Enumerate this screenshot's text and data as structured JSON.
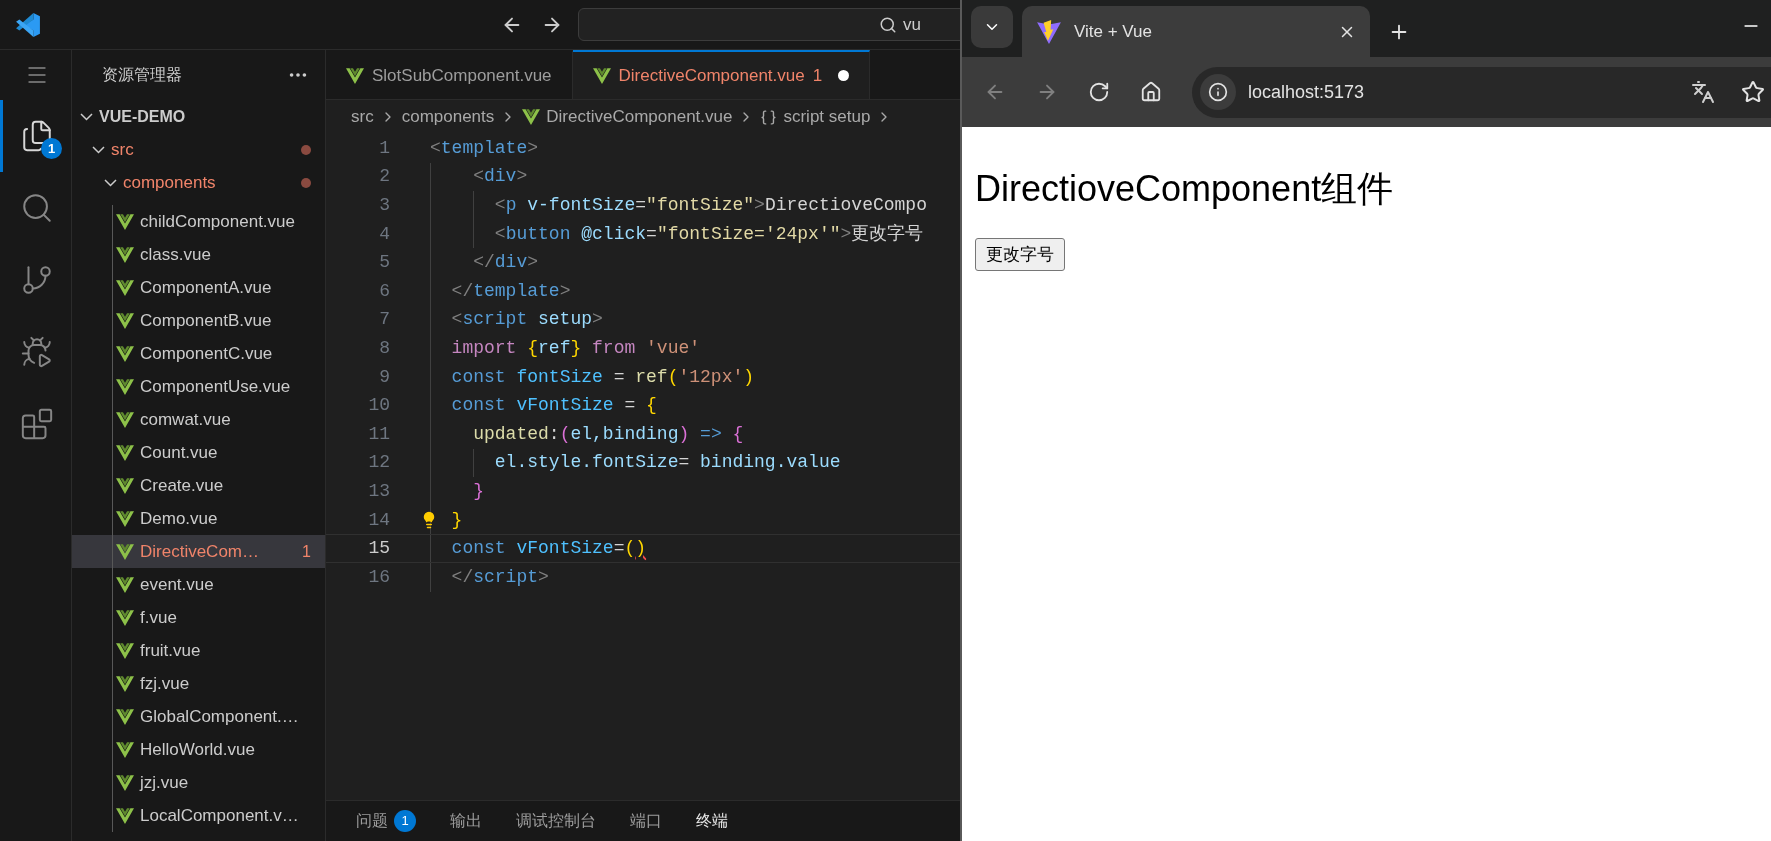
{
  "title_bar": {
    "search": {
      "value": "vu"
    }
  },
  "activity_bar": [
    {
      "kind": "menu",
      "selected": false
    },
    {
      "kind": "explorer",
      "selected": true,
      "badge": "1"
    },
    {
      "kind": "search",
      "selected": false
    },
    {
      "kind": "source-control",
      "selected": false
    },
    {
      "kind": "run-debug",
      "selected": false
    },
    {
      "kind": "extensions",
      "selected": false
    }
  ],
  "sidebar": {
    "title": "资源管理器",
    "tree": [
      {
        "name": "VUE-DEMO",
        "kind": "root",
        "expanded": true,
        "problem": false,
        "selected": false,
        "children": [
          {
            "name": "src",
            "kind": "folder",
            "expanded": true,
            "problem": true,
            "selected": false,
            "children": [
              {
                "name": "components",
                "kind": "folder",
                "expanded": true,
                "problem": true,
                "selected": false,
                "children": [
                  {
                    "name": "childComponent.vue",
                    "kind": "file",
                    "problem": false,
                    "selected": false
                  },
                  {
                    "name": "class.vue",
                    "kind": "file",
                    "problem": false,
                    "selected": false
                  },
                  {
                    "name": "ComponentA.vue",
                    "kind": "file",
                    "problem": false,
                    "selected": false
                  },
                  {
                    "name": "ComponentB.vue",
                    "kind": "file",
                    "problem": false,
                    "selected": false
                  },
                  {
                    "name": "ComponentC.vue",
                    "kind": "file",
                    "problem": false,
                    "selected": false
                  },
                  {
                    "name": "ComponentUse.vue",
                    "kind": "file",
                    "problem": false,
                    "selected": false
                  },
                  {
                    "name": "comwat.vue",
                    "kind": "file",
                    "problem": false,
                    "selected": false
                  },
                  {
                    "name": "Count.vue",
                    "kind": "file",
                    "problem": false,
                    "selected": false
                  },
                  {
                    "name": "Create.vue",
                    "kind": "file",
                    "problem": false,
                    "selected": false
                  },
                  {
                    "name": "Demo.vue",
                    "kind": "file",
                    "problem": false,
                    "selected": false
                  },
                  {
                    "name": "DirectiveCom…",
                    "kind": "file",
                    "problem": true,
                    "selected": true,
                    "badge": "1"
                  },
                  {
                    "name": "event.vue",
                    "kind": "file",
                    "problem": false,
                    "selected": false
                  },
                  {
                    "name": "f.vue",
                    "kind": "file",
                    "problem": false,
                    "selected": false
                  },
                  {
                    "name": "fruit.vue",
                    "kind": "file",
                    "problem": false,
                    "selected": false
                  },
                  {
                    "name": "fzj.vue",
                    "kind": "file",
                    "problem": false,
                    "selected": false
                  },
                  {
                    "name": "GlobalComponent.…",
                    "kind": "file",
                    "problem": false,
                    "selected": false
                  },
                  {
                    "name": "HelloWorld.vue",
                    "kind": "file",
                    "problem": false,
                    "selected": false
                  },
                  {
                    "name": "jzj.vue",
                    "kind": "file",
                    "problem": false,
                    "selected": false
                  },
                  {
                    "name": "LocalComponent.v…",
                    "kind": "file",
                    "problem": false,
                    "selected": false
                  }
                ]
              }
            ]
          }
        ]
      }
    ]
  },
  "editor": {
    "tabs": [
      {
        "label": "SlotSubComponent.vue",
        "selected": false,
        "problem": false,
        "modified": false
      },
      {
        "label": "DirectiveComponent.vue",
        "selected": true,
        "problem": true,
        "badge": "1",
        "modified": true
      }
    ],
    "breadcrumb": [
      {
        "text": "src",
        "kind": "folder"
      },
      {
        "text": "components",
        "kind": "folder"
      },
      {
        "text": "DirectiveComponent.vue",
        "kind": "vue-file"
      },
      {
        "text": "script setup",
        "kind": "symbol"
      }
    ],
    "lines": [
      {
        "number": "1",
        "current": false,
        "hint": false,
        "tokens": [
          {
            "text": "<",
            "kind": "punct"
          },
          {
            "text": "template",
            "kind": "tag"
          },
          {
            "text": ">",
            "kind": "punct"
          }
        ]
      },
      {
        "number": "2",
        "current": false,
        "hint": false,
        "tokens": [
          {
            "text": "    <",
            "kind": "punct"
          },
          {
            "text": "div",
            "kind": "tag"
          },
          {
            "text": ">",
            "kind": "punct"
          }
        ]
      },
      {
        "number": "3",
        "current": false,
        "hint": false,
        "tokens": [
          {
            "text": "      <",
            "kind": "punct"
          },
          {
            "text": "p",
            "kind": "tag"
          },
          {
            "text": " v-fontSize",
            "kind": "attr"
          },
          {
            "text": "=",
            "kind": "op"
          },
          {
            "text": "\"fontSize\"",
            "kind": "expr"
          },
          {
            "text": ">",
            "kind": "punct"
          },
          {
            "text": "DirectioveCompo",
            "kind": "text"
          }
        ]
      },
      {
        "number": "4",
        "current": false,
        "hint": false,
        "tokens": [
          {
            "text": "      <",
            "kind": "punct"
          },
          {
            "text": "button",
            "kind": "tag"
          },
          {
            "text": " @click",
            "kind": "attr"
          },
          {
            "text": "=",
            "kind": "op"
          },
          {
            "text": "\"fontSize='24px'\"",
            "kind": "expr"
          },
          {
            "text": ">",
            "kind": "punct"
          },
          {
            "text": "更改字号",
            "kind": "text"
          }
        ]
      },
      {
        "number": "5",
        "current": false,
        "hint": false,
        "tokens": [
          {
            "text": "    </",
            "kind": "punct"
          },
          {
            "text": "div",
            "kind": "tag"
          },
          {
            "text": ">",
            "kind": "punct"
          }
        ]
      },
      {
        "number": "6",
        "current": false,
        "hint": false,
        "tokens": [
          {
            "text": "  </",
            "kind": "punct"
          },
          {
            "text": "template",
            "kind": "tag"
          },
          {
            "text": ">",
            "kind": "punct"
          }
        ]
      },
      {
        "number": "7",
        "current": false,
        "hint": false,
        "tokens": [
          {
            "text": "  <",
            "kind": "punct"
          },
          {
            "text": "script",
            "kind": "tag"
          },
          {
            "text": " setup",
            "kind": "attr"
          },
          {
            "text": ">",
            "kind": "punct"
          }
        ]
      },
      {
        "number": "8",
        "current": false,
        "hint": false,
        "tokens": [
          {
            "text": "  import ",
            "kind": "keyword"
          },
          {
            "text": "{",
            "kind": "bracket1"
          },
          {
            "text": "ref",
            "kind": "variable"
          },
          {
            "text": "}",
            "kind": "bracket1"
          },
          {
            "text": " from ",
            "kind": "keyword"
          },
          {
            "text": "'vue'",
            "kind": "string"
          }
        ]
      },
      {
        "number": "9",
        "current": false,
        "hint": false,
        "tokens": [
          {
            "text": "  const ",
            "kind": "storage"
          },
          {
            "text": "fontSize",
            "kind": "constant"
          },
          {
            "text": " = ",
            "kind": "op"
          },
          {
            "text": "ref",
            "kind": "func"
          },
          {
            "text": "(",
            "kind": "bracket1"
          },
          {
            "text": "'12px'",
            "kind": "string"
          },
          {
            "text": ")",
            "kind": "bracket1"
          }
        ]
      },
      {
        "number": "10",
        "current": false,
        "hint": false,
        "tokens": [
          {
            "text": "  const ",
            "kind": "storage"
          },
          {
            "text": "vFontSize",
            "kind": "constant"
          },
          {
            "text": " = ",
            "kind": "op"
          },
          {
            "text": "{",
            "kind": "bracket1"
          }
        ]
      },
      {
        "number": "11",
        "current": false,
        "hint": false,
        "tokens": [
          {
            "text": "    updated",
            "kind": "func"
          },
          {
            "text": ":",
            "kind": "op"
          },
          {
            "text": "(",
            "kind": "bracket2"
          },
          {
            "text": "el,binding",
            "kind": "variable"
          },
          {
            "text": ")",
            "kind": "bracket2"
          },
          {
            "text": " => ",
            "kind": "storage"
          },
          {
            "text": "{",
            "kind": "bracket2"
          }
        ]
      },
      {
        "number": "12",
        "current": false,
        "hint": false,
        "tokens": [
          {
            "text": "      el.style.fontSize",
            "kind": "variable"
          },
          {
            "text": "= ",
            "kind": "op"
          },
          {
            "text": "binding.value",
            "kind": "variable"
          }
        ]
      },
      {
        "number": "13",
        "current": false,
        "hint": false,
        "tokens": [
          {
            "text": "    }",
            "kind": "bracket2"
          }
        ]
      },
      {
        "number": "14",
        "current": false,
        "hint": true,
        "tokens": [
          {
            "text": "  }",
            "kind": "bracket1"
          }
        ]
      },
      {
        "number": "15",
        "current": true,
        "hint": false,
        "tokens": [
          {
            "text": "  const ",
            "kind": "storage"
          },
          {
            "text": "vFontSize",
            "kind": "constant"
          },
          {
            "text": "=",
            "kind": "op"
          },
          {
            "text": "(",
            "kind": "bracket1"
          },
          {
            "text": ")",
            "kind": "error"
          }
        ]
      },
      {
        "number": "16",
        "current": false,
        "hint": false,
        "tokens": [
          {
            "text": "  </",
            "kind": "punct"
          },
          {
            "text": "script",
            "kind": "tag"
          },
          {
            "text": ">",
            "kind": "punct"
          }
        ]
      }
    ]
  },
  "panel_tabs": [
    {
      "label": "问题",
      "selected": false,
      "badge": "1"
    },
    {
      "label": "输出",
      "selected": false
    },
    {
      "label": "调试控制台",
      "selected": false
    },
    {
      "label": "端口",
      "selected": false
    },
    {
      "label": "终端",
      "selected": true
    }
  ],
  "browser": {
    "tabs": [
      {
        "title": "Vite + Vue",
        "selected": true
      }
    ],
    "nav": [
      {
        "kind": "back",
        "disabled": true
      },
      {
        "kind": "forward",
        "disabled": true
      },
      {
        "kind": "reload",
        "disabled": false
      },
      {
        "kind": "home",
        "disabled": false
      }
    ],
    "address": "localhost:5173",
    "page": {
      "heading": "DirectioveComponent组件",
      "button": "更改字号"
    }
  }
}
